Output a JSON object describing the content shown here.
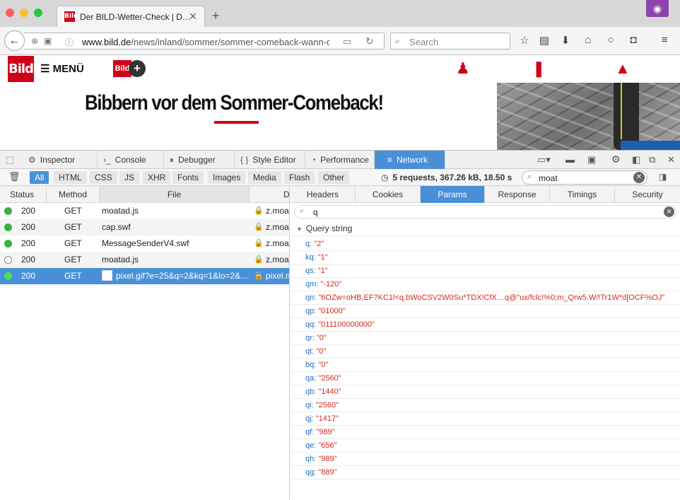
{
  "browser": {
    "tab_title": "Der BILD-Wetter-Check | D…",
    "tab_favicon": "Bild",
    "url_domain": "www.bild.de",
    "url_path": "/news/inland/sommer/sommer-comeback-wann-c",
    "search_placeholder": "Search"
  },
  "page": {
    "logo": "Bild",
    "menu_label": "MENÜ",
    "bildplus_label": "Bild",
    "headline": "Bibbern vor dem Sommer-Comeback!"
  },
  "devtools": {
    "tabs": [
      {
        "label": "Inspector",
        "icon": "inspector-icon"
      },
      {
        "label": "Console",
        "icon": "console-icon"
      },
      {
        "label": "Debugger",
        "icon": "debugger-icon"
      },
      {
        "label": "Style Editor",
        "icon": "style-editor-icon"
      },
      {
        "label": "Performance",
        "icon": "performance-icon"
      },
      {
        "label": "Network",
        "icon": "network-icon"
      }
    ],
    "active_tab": "Network",
    "filters": [
      "All",
      "HTML",
      "CSS",
      "JS",
      "XHR",
      "Fonts",
      "Images",
      "Media",
      "Flash",
      "Other"
    ],
    "active_filter": "All",
    "summary": "5 requests, 367.26 kB, 18.50 s",
    "filter_value": "moat",
    "columns": {
      "status": "Status",
      "method": "Method",
      "file": "File",
      "domain": "D"
    },
    "requests": [
      {
        "status": "200",
        "method": "GET",
        "file": "moatad.js",
        "domain": "z.moat",
        "cached": false
      },
      {
        "status": "200",
        "method": "GET",
        "file": "cap.swf",
        "domain": "z.moat",
        "cached": false
      },
      {
        "status": "200",
        "method": "GET",
        "file": "MessageSenderV4.swf",
        "domain": "z.moat",
        "cached": false
      },
      {
        "status": "200",
        "method": "GET",
        "file": "moatad.js",
        "domain": "z.moat",
        "cached": true
      },
      {
        "status": "200",
        "method": "GET",
        "file": "pixel.gif?e=25&q=2&kq=1&lo=2&…",
        "domain": "pixel.m",
        "cached": false
      }
    ],
    "selected_request": 4,
    "detail_tabs": [
      "Headers",
      "Cookies",
      "Params",
      "Response",
      "Timings",
      "Security"
    ],
    "active_detail_tab": "Params",
    "param_filter_value": "q",
    "query_string_label": "Query string",
    "params": [
      {
        "key": "q:",
        "value": "\"2\""
      },
      {
        "key": "kq:",
        "value": "\"1\""
      },
      {
        "key": "qs:",
        "value": "\"1\""
      },
      {
        "key": "qm:",
        "value": "\"-120\""
      },
      {
        "key": "qn:",
        "value": "\"6OZw=oHB,EF?KC1l<q.bWoCSV2W0Su*TDX!CfX…q@\"ux/fclc!%0;m_Qrw5.W/!Tr1W*d[OCF%OJ\""
      },
      {
        "key": "qp:",
        "value": "\"01000\""
      },
      {
        "key": "qq:",
        "value": "\"011100000000\""
      },
      {
        "key": "qr:",
        "value": "\"0\""
      },
      {
        "key": "qt:",
        "value": "\"0\""
      },
      {
        "key": "bq:",
        "value": "\"0\""
      },
      {
        "key": "qa:",
        "value": "\"2560\""
      },
      {
        "key": "qb:",
        "value": "\"1440\""
      },
      {
        "key": "qi:",
        "value": "\"2560\""
      },
      {
        "key": "qj:",
        "value": "\"1417\""
      },
      {
        "key": "qf:",
        "value": "\"989\""
      },
      {
        "key": "qe:",
        "value": "\"656\""
      },
      {
        "key": "qh:",
        "value": "\"989\""
      },
      {
        "key": "qg:",
        "value": "\"889\""
      }
    ]
  },
  "colors": {
    "bild_red": "#d0021b",
    "devtools_accent": "#4a90d9",
    "param_key": "#1f6fbf",
    "param_value": "#d52b1e",
    "status_ok": "#3cb043"
  }
}
